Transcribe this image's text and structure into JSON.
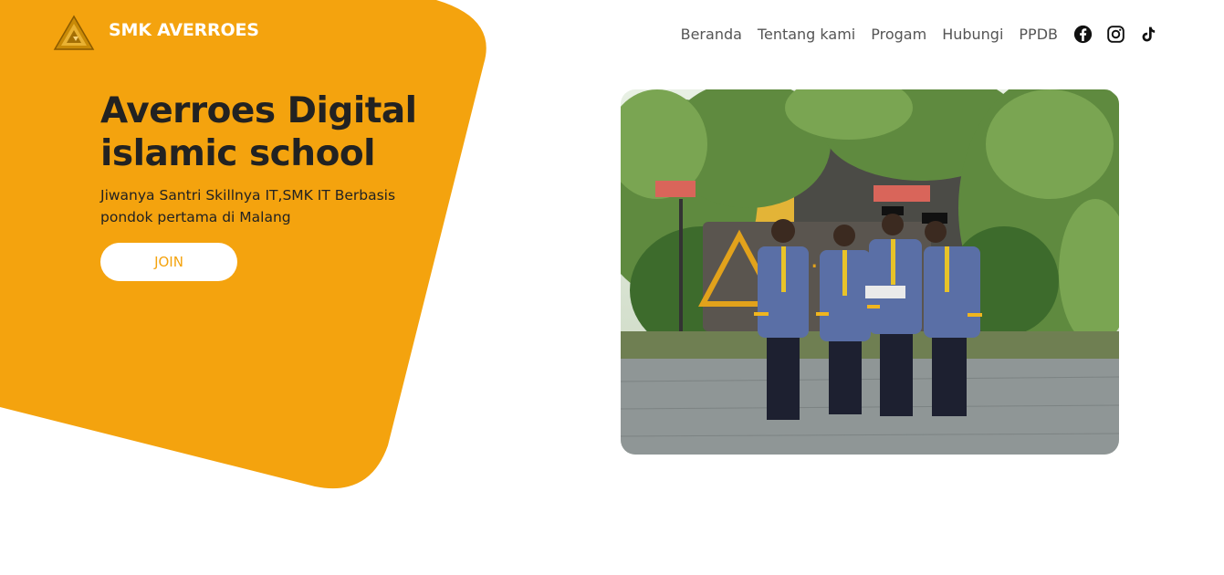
{
  "brand": {
    "name": "SMK AVERROES",
    "logo_icon": "triangle-logo-icon"
  },
  "nav": {
    "links": [
      "Beranda",
      "Tentang kami",
      "Progam",
      "Hubungi",
      "PPDB"
    ],
    "social_icons": [
      "facebook-icon",
      "instagram-icon",
      "tiktok-icon"
    ]
  },
  "hero": {
    "title_line1": "Averroes Digital",
    "title_line2": "islamic school",
    "subtitle_line1": "Jiwanya Santri Skillnya IT,SMK IT Berbasis",
    "subtitle_line2": "pondok pertama di Malang",
    "join_label": "JOIN",
    "image": "photo-of-four-students-in-uniform"
  },
  "colors": {
    "accent": "#f4a30e",
    "text_dark": "#222222",
    "nav_text": "#555555",
    "background": "#ffffff"
  }
}
